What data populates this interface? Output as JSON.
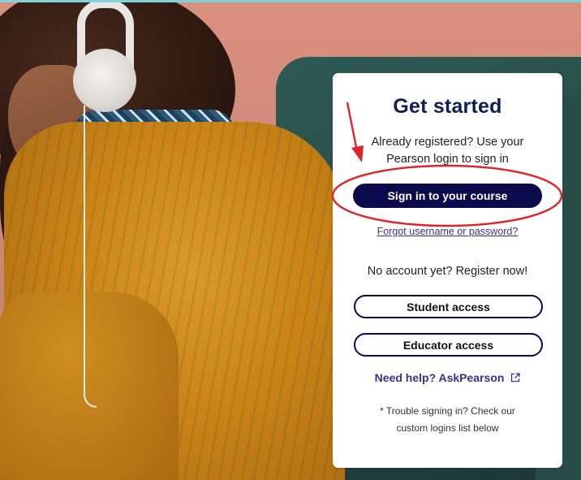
{
  "card": {
    "title": "Get started",
    "registered_text": "Already registered? Use your Pearson login to sign in",
    "signin_button": "Sign in to your course",
    "forgot_link": "Forgot username or password?",
    "no_account_text": "No account yet? Register now!",
    "student_button": "Student access",
    "educator_button": "Educator access",
    "help_link": "Need help? AskPearson",
    "help_icon": "external-link-icon",
    "trouble_text": "* Trouble signing in? Check our custom logins list below"
  },
  "colors": {
    "brand_navy": "#0b0a4d",
    "title": "#0c1e55",
    "link": "#3c2f8e",
    "annotation_red": "#e0232a"
  }
}
